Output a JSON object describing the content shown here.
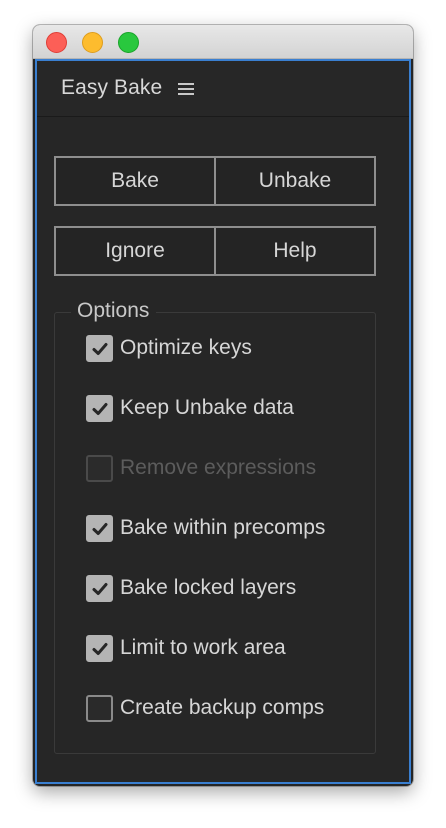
{
  "panel": {
    "title": "Easy Bake",
    "menu_icon": "hamburger-menu-icon"
  },
  "buttons": {
    "bake": "Bake",
    "unbake": "Unbake",
    "ignore": "Ignore",
    "help": "Help"
  },
  "options": {
    "legend": "Options",
    "items": [
      {
        "label": "Optimize keys",
        "checked": true,
        "enabled": true
      },
      {
        "label": "Keep Unbake data",
        "checked": true,
        "enabled": true
      },
      {
        "label": "Remove expressions",
        "checked": false,
        "enabled": false
      },
      {
        "label": "Bake within precomps",
        "checked": true,
        "enabled": true
      },
      {
        "label": "Bake locked layers",
        "checked": true,
        "enabled": true
      },
      {
        "label": "Limit to work area",
        "checked": true,
        "enabled": true
      },
      {
        "label": "Create backup comps",
        "checked": false,
        "enabled": true
      }
    ]
  },
  "colors": {
    "panel_bg": "#262626",
    "focus_border": "#3a7fd0",
    "text": "#d6d6d6",
    "disabled_text": "#5c5c5c",
    "checkbox_checked": "#b4b4b4"
  }
}
